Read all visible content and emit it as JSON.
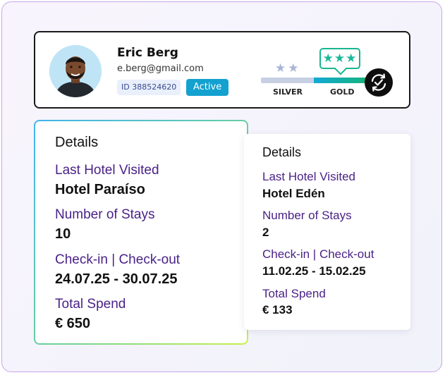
{
  "profile": {
    "name": "Eric Berg",
    "email": "e.berg@gmail.com",
    "id_label": "ID 388524620",
    "status": "Active",
    "tiers": {
      "silver_label": "SILVER",
      "gold_label": "GOLD",
      "silver_stars": 2,
      "gold_stars": 3,
      "current_tier": "GOLD"
    },
    "icons": {
      "avatar": "user-photo",
      "sync": "sync-check-icon",
      "star": "star-icon"
    }
  },
  "details_primary": {
    "title": "Details",
    "fields": [
      {
        "label": "Last Hotel Visited",
        "value": "Hotel Paraíso"
      },
      {
        "label": "Number of Stays",
        "value": "10"
      },
      {
        "label": "Check-in | Check-out",
        "value": "24.07.25 - 30.07.25"
      },
      {
        "label": "Total Spend",
        "value": "€ 650"
      }
    ]
  },
  "details_secondary": {
    "title": "Details",
    "fields": [
      {
        "label": "Last Hotel Visited",
        "value": "Hotel Edén"
      },
      {
        "label": "Number of Stays",
        "value": "2"
      },
      {
        "label": "Check-in | Check-out",
        "value": "11.02.25 - 15.02.25"
      },
      {
        "label": "Total Spend",
        "value": "€ 133"
      }
    ]
  },
  "colors": {
    "accent": "#13a1cf",
    "label_purple": "#4a2287",
    "gold_green": "#18b690",
    "silver": "#a8b5d6",
    "frame_border": "#c9a6e8"
  }
}
